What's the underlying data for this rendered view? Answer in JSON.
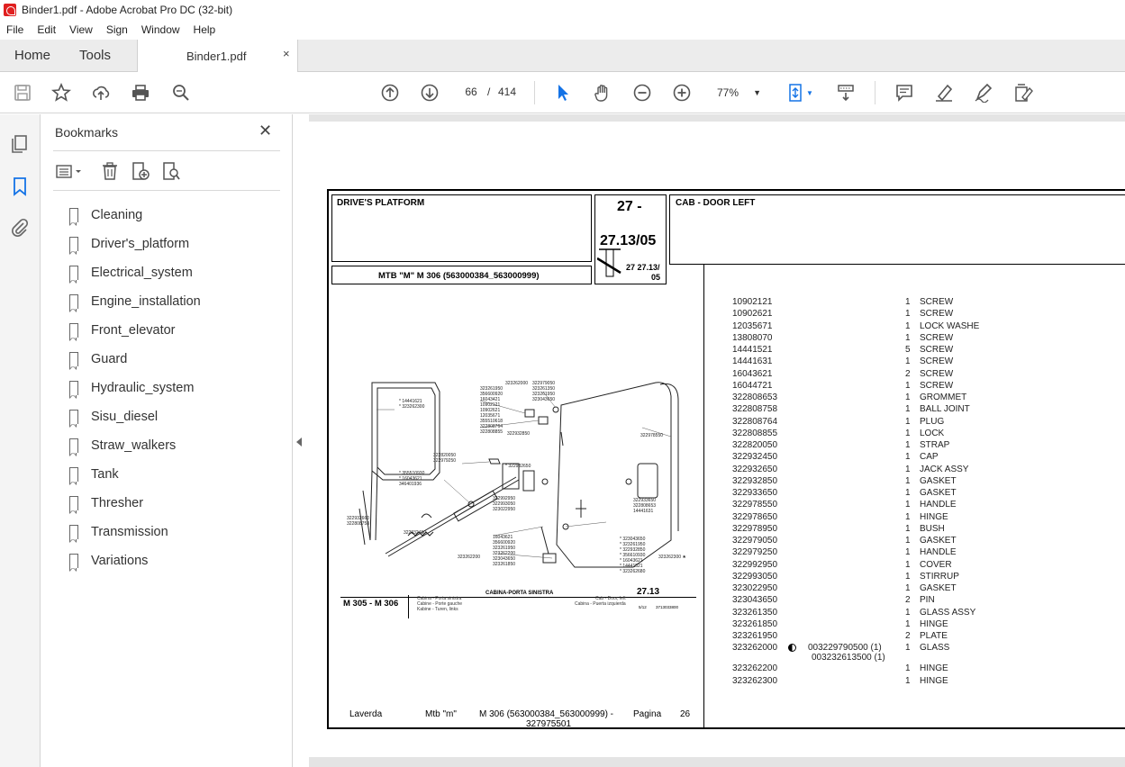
{
  "window": {
    "title": "Binder1.pdf - Adobe Acrobat Pro DC (32-bit)"
  },
  "menu": [
    "File",
    "Edit",
    "View",
    "Sign",
    "Window",
    "Help"
  ],
  "tabs": {
    "home": "Home",
    "tools": "Tools",
    "document": "Binder1.pdf",
    "close": "×"
  },
  "toolbar": {
    "current_page": "66",
    "page_separator": "/",
    "total_pages": "414",
    "zoom": "77%",
    "icons": [
      "save-icon",
      "star-icon",
      "upload-icon",
      "print-icon",
      "search-zoom-icon",
      "arrow-up-circle-icon",
      "arrow-down-circle-icon",
      "select-pointer-icon",
      "hand-icon",
      "zoom-out-icon",
      "zoom-in-icon",
      "fit-page-icon",
      "scroll-mode-icon",
      "comment-icon",
      "highlight-icon",
      "sign-pen-icon",
      "edit-form-icon"
    ]
  },
  "bookmarks": {
    "title": "Bookmarks",
    "close": "✕",
    "items": [
      "Cleaning",
      "Driver's_platform",
      "Electrical_system",
      "Engine_installation",
      "Front_elevator",
      "Guard",
      "Hydraulic_system",
      "Sisu_diesel",
      "Straw_walkers",
      "Tank",
      "Thresher",
      "Transmission",
      "Variations"
    ]
  },
  "pdf": {
    "section": "DRIVE'S PLATFORM",
    "group_top": "27 -",
    "group_code": "27.13/05",
    "group_code_small": "27 27.13/",
    "group_code_small2": "05",
    "title": "CAB - DOOR LEFT",
    "model": "MTB \"M\" M 306 (563000384_563000999)",
    "drawing": {
      "model_label": "M 305 - M 306",
      "caption_it": "Cabina - Porta sinistra",
      "caption_fr": "Cabine - Porte gauche",
      "caption_de": "Kabine - Turen, links",
      "caption_center": "CABINA-PORTA SINISTRA",
      "caption_en": "Cab - Door, left",
      "caption_es": "Cabina - Puerta izquierda",
      "ref": "27.13",
      "sheet": "5/12",
      "sheet_code": "3713033800"
    },
    "footer": {
      "brand": "Laverda",
      "mtb": "Mtb \"m\"",
      "model": "M 306 (563000384_563000999)  -",
      "code": "327975501",
      "page_label": "Pagina",
      "page_num": "26"
    },
    "parts": [
      {
        "pn": "10902121",
        "qty": "1",
        "desc": "SCREW"
      },
      {
        "pn": "10902621",
        "qty": "1",
        "desc": "SCREW"
      },
      {
        "pn": "12035671",
        "qty": "1",
        "desc": "LOCK WASHE"
      },
      {
        "pn": "13808070",
        "qty": "1",
        "desc": "SCREW"
      },
      {
        "pn": "14441521",
        "qty": "5",
        "desc": "SCREW"
      },
      {
        "pn": "14441631",
        "qty": "1",
        "desc": "SCREW"
      },
      {
        "pn": "16043621",
        "qty": "2",
        "desc": "SCREW"
      },
      {
        "pn": "16044721",
        "qty": "1",
        "desc": "SCREW"
      },
      {
        "pn": "322808653",
        "qty": "1",
        "desc": "GROMMET"
      },
      {
        "pn": "322808758",
        "qty": "1",
        "desc": "BALL JOINT"
      },
      {
        "pn": "322808764",
        "qty": "1",
        "desc": "PLUG"
      },
      {
        "pn": "322808855",
        "qty": "1",
        "desc": "LOCK"
      },
      {
        "pn": "322820050",
        "qty": "1",
        "desc": "STRAP"
      },
      {
        "pn": "322932450",
        "qty": "1",
        "desc": "CAP"
      },
      {
        "pn": "322932650",
        "qty": "1",
        "desc": "JACK ASSY"
      },
      {
        "pn": "322932850",
        "qty": "1",
        "desc": "GASKET"
      },
      {
        "pn": "322933650",
        "qty": "1",
        "desc": "GASKET"
      },
      {
        "pn": "322978550",
        "qty": "1",
        "desc": "HANDLE"
      },
      {
        "pn": "322978650",
        "qty": "1",
        "desc": "HINGE"
      },
      {
        "pn": "322978950",
        "qty": "1",
        "desc": "BUSH"
      },
      {
        "pn": "322979050",
        "qty": "1",
        "desc": "GASKET"
      },
      {
        "pn": "322979250",
        "qty": "1",
        "desc": "HANDLE"
      },
      {
        "pn": "322992950",
        "qty": "1",
        "desc": "COVER"
      },
      {
        "pn": "322993050",
        "qty": "1",
        "desc": "STIRRUP"
      },
      {
        "pn": "323022950",
        "qty": "1",
        "desc": "GASKET"
      },
      {
        "pn": "323043650",
        "qty": "2",
        "desc": "PIN"
      },
      {
        "pn": "323261350",
        "qty": "1",
        "desc": "GLASS ASSY"
      },
      {
        "pn": "323261850",
        "qty": "1",
        "desc": "HINGE"
      },
      {
        "pn": "323261950",
        "qty": "2",
        "desc": "PLATE"
      },
      {
        "pn": "323262000",
        "qty": "1",
        "desc": "GLASS",
        "extra": "003229790500  (1)",
        "extra2": "003232613500  (1)"
      },
      {
        "pn": "323262200",
        "qty": "1",
        "desc": "HINGE"
      },
      {
        "pn": "323262300",
        "qty": "1",
        "desc": "HINGE"
      }
    ]
  }
}
